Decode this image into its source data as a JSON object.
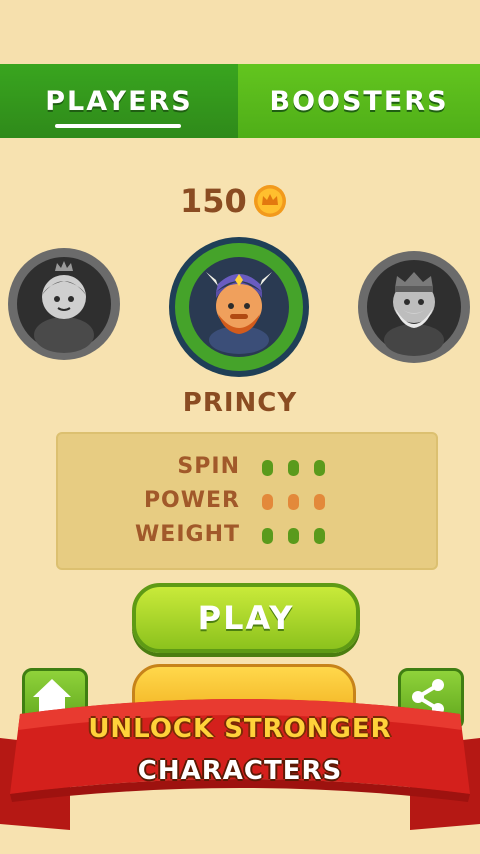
{
  "tabs": {
    "players_label": "PLAYERS",
    "boosters_label": "BOOSTERS",
    "selected": "players"
  },
  "coins": {
    "count": "150",
    "icon": "crown-coin-icon"
  },
  "carousel": {
    "left_character": "princess-character-icon",
    "center_character": "viking-character-icon",
    "right_character": "king-character-icon",
    "left_locked": true,
    "right_locked": true
  },
  "player": {
    "name": "PRINCY"
  },
  "stats": [
    {
      "label": "SPIN",
      "level": 3,
      "max": 3,
      "color": "#5a9a1c"
    },
    {
      "label": "POWER",
      "level": 3,
      "max": 3,
      "color": "#e3893a"
    },
    {
      "label": "WEIGHT",
      "level": 3,
      "max": 3,
      "color": "#5a9a1c"
    }
  ],
  "buttons": {
    "play_label": "PLAY",
    "home_icon": "home-icon",
    "share_icon": "share-icon"
  },
  "banner": {
    "line1": "UNLOCK STRONGER",
    "line2": "CHARACTERS"
  },
  "colors": {
    "background": "#f7e2b0",
    "tab_active": "#2f8a1a",
    "tab_inactive": "#55b31b",
    "text_brown": "#8a4c22",
    "banner_red": "#d4201c"
  }
}
